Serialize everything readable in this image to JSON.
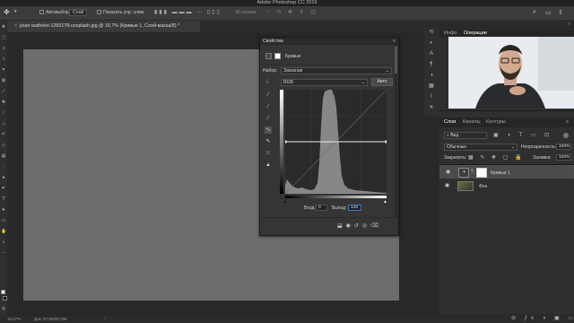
{
  "app": {
    "title": "Adobe Photoshop CC 2019"
  },
  "options_bar": {
    "autoselect_label": "Автовыбор:",
    "autoselect_value": "Слой",
    "transform_label": "Показать упр. элем.",
    "mode3d_label": "3D-режим:"
  },
  "document": {
    "tab_label": "jolan-wathelet-1260178-unsplash.jpg @ 16,7% (Кривые 1, Слой-маска/8) *",
    "canvas_color": "#6d6d6d"
  },
  "statusbar": {
    "zoom": "16,67%",
    "doc_info": "Док: 57,5M/57,5M"
  },
  "properties_panel": {
    "title": "Свойства",
    "adjustment_label": "Кривые",
    "preset_label": "Набор:",
    "preset_value": "Заказная",
    "channel_value": "RGB",
    "auto_button": "Авто",
    "input_label": "Вход:",
    "input_value": "0",
    "output_label": "Выход:",
    "output_value": "128"
  },
  "right_top": {
    "tabs": [
      "Инфо",
      "Операции"
    ],
    "active_tab": "Операции"
  },
  "layers_panel": {
    "tabs": [
      "Слои",
      "Каналы",
      "Контуры"
    ],
    "active_tab": "Слои",
    "kind_filter": "Вид",
    "blend_mode": "Обычные",
    "opacity_label": "Непрозрачность:",
    "opacity_value": "100%",
    "lock_label": "Закрепить:",
    "fill_label": "Заливка:",
    "fill_value": "100%",
    "layers": [
      {
        "name": "Кривые 1",
        "selected": true
      },
      {
        "name": "Фон",
        "selected": false
      }
    ]
  },
  "colors": {
    "accent": "#3a78c0",
    "panel_bg": "#353535",
    "canvas": "#6d6d6d"
  }
}
